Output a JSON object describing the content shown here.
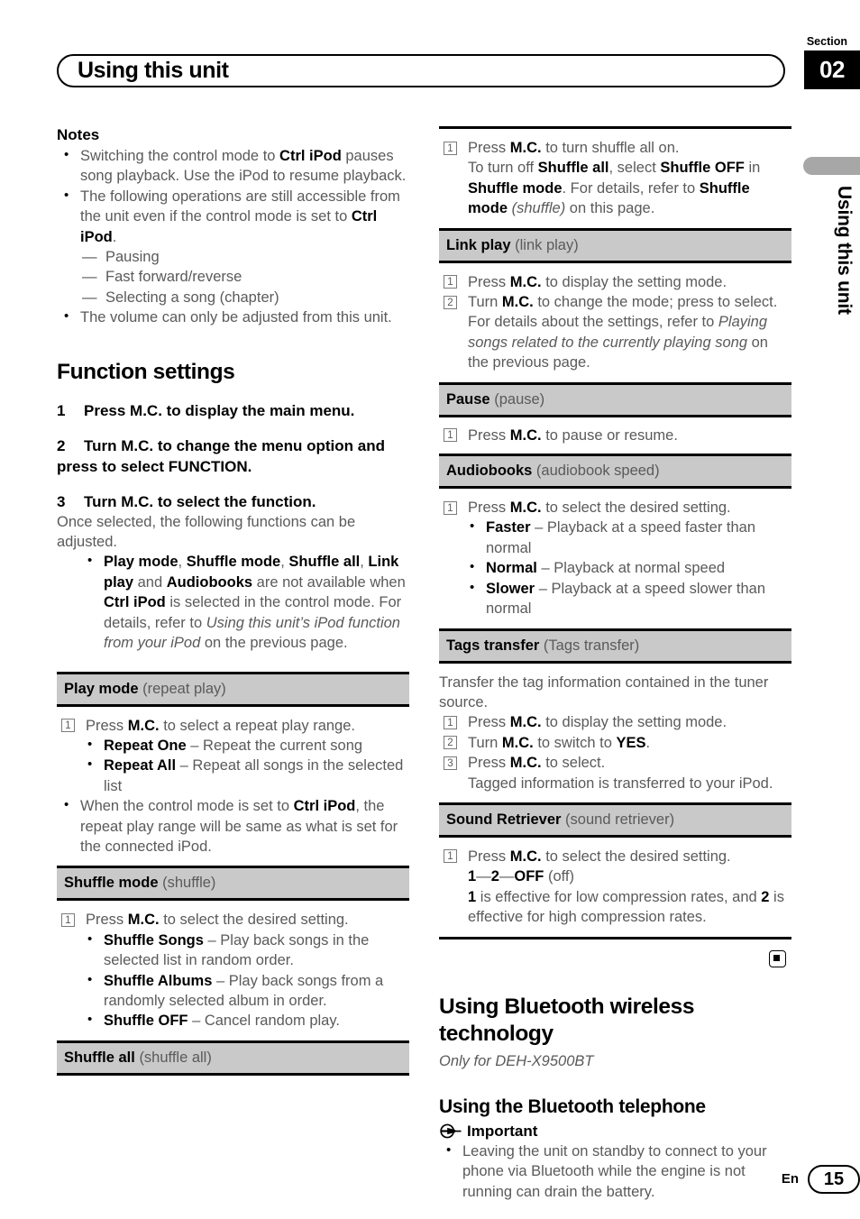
{
  "header": {
    "title": "Using this unit",
    "section_word": "Section",
    "section_number": "02"
  },
  "side_tab": {
    "label": "Using this unit"
  },
  "footer": {
    "lang": "En",
    "page": "15"
  },
  "left_column": {
    "notes_heading": "Notes",
    "notes": [
      "Switching the control mode to <b>Ctrl iPod</b> pauses song playback. Use the iPod to resume playback.",
      "The following operations are still accessible from the unit even if the control mode is set to <b>Ctrl iPod</b>.",
      "The volume can only be adjusted from this unit."
    ],
    "notes_sub_items": [
      "Pausing",
      "Fast forward/reverse",
      "Selecting a song (chapter)"
    ],
    "function_settings": {
      "heading": "Function settings",
      "steps": [
        {
          "n": "1",
          "text": "Press M.C. to display the main menu."
        },
        {
          "n": "2",
          "text": "Turn M.C. to change the menu option and press to select FUNCTION."
        },
        {
          "n": "3",
          "text": "Turn M.C. to select the function."
        }
      ],
      "intro": "Once selected, the following functions can be adjusted.",
      "bullet": "<b>Play mode</b>, <b>Shuffle mode</b>, <b>Shuffle all</b>, <b>Link play</b> and <b>Audiobooks</b> are not available when <b>Ctrl iPod</b> is selected in the control mode. For details, refer to <i>Using this unit&rsquo;s iPod function from your iPod</i> on the previous page."
    },
    "functions": [
      {
        "name": "Play mode",
        "display": "(repeat play)",
        "steps": [
          {
            "n": "1",
            "text": "Press <b>M.C.</b> to select a repeat play range."
          }
        ],
        "sub_bullets": [
          "<b>Repeat One</b> &ndash; Repeat the current song",
          "<b>Repeat All</b> &ndash; Repeat all songs in the selected list"
        ],
        "bullets": [
          "When the control mode is set to <b>Ctrl iPod</b>, the repeat play range will be same as what is set for the connected iPod."
        ]
      },
      {
        "name": "Shuffle mode",
        "display": "(shuffle)",
        "steps": [
          {
            "n": "1",
            "text": "Press <b>M.C.</b> to select the desired setting."
          }
        ],
        "sub_bullets": [
          "<b>Shuffle Songs</b> &ndash; Play back songs in the selected list in random order.",
          "<b>Shuffle Albums</b> &ndash; Play back songs from a randomly selected album in order.",
          "<b>Shuffle OFF</b> &ndash; Cancel random play."
        ],
        "bullets": []
      },
      {
        "name": "Shuffle all",
        "display": "(shuffle all)",
        "steps": [],
        "sub_bullets": [],
        "bullets": []
      }
    ]
  },
  "right_column": {
    "shuffle_all_body": {
      "steps": [
        {
          "n": "1",
          "text": "Press <b>M.C.</b> to turn shuffle all on.<br>To turn off <b>Shuffle all</b>, select <b>Shuffle OFF</b> in <b>Shuffle mode</b>. For details, refer to <b>Shuffle mode</b> <i>(shuffle)</i> on this page."
        }
      ]
    },
    "functions": [
      {
        "name": "Link play",
        "display": "(link play)",
        "steps": [
          {
            "n": "1",
            "text": "Press <b>M.C.</b> to display the setting mode."
          },
          {
            "n": "2",
            "text": "Turn <b>M.C.</b> to change the mode; press to select.<br>For details about the settings, refer to <i>Playing songs related to the currently playing song</i> on the previous page."
          }
        ],
        "intro": "",
        "sub_bullets": []
      },
      {
        "name": "Pause",
        "display": "(pause)",
        "steps": [
          {
            "n": "1",
            "text": "Press <b>M.C.</b> to pause or resume."
          }
        ],
        "intro": "",
        "sub_bullets": []
      },
      {
        "name": "Audiobooks",
        "display": "(audiobook speed)",
        "steps": [
          {
            "n": "1",
            "text": "Press <b>M.C.</b> to select the desired setting."
          }
        ],
        "intro": "",
        "sub_bullets": [
          "<b>Faster</b> &ndash; Playback at a speed faster than normal",
          "<b>Normal</b> &ndash; Playback at normal speed",
          "<b>Slower</b> &ndash; Playback at a speed slower than normal"
        ]
      },
      {
        "name": "Tags transfer",
        "display": "(Tags transfer)",
        "intro": "Transfer the tag information contained in the tuner source.",
        "steps": [
          {
            "n": "1",
            "text": "Press <b>M.C.</b> to display the setting mode."
          },
          {
            "n": "2",
            "text": "Turn <b>M.C.</b> to switch to <b>YES</b>."
          },
          {
            "n": "3",
            "text": "Press <b>M.C.</b> to select.<br>Tagged information is transferred to your iPod."
          }
        ],
        "sub_bullets": []
      },
      {
        "name": "Sound Retriever",
        "display": "(sound retriever)",
        "intro": "",
        "steps": [
          {
            "n": "1",
            "text": "Press <b>M.C.</b> to select the desired setting.<br><b>1</b>&mdash;<b>2</b>&mdash;<b>OFF</b> (off)<br><b>1</b> is effective for low compression rates, and <b>2</b> is effective for high compression rates."
          }
        ],
        "sub_bullets": []
      }
    ],
    "bluetooth": {
      "heading": "Using Bluetooth wireless technology",
      "subnote": "Only for DEH-X9500BT",
      "subheading": "Using the Bluetooth telephone",
      "important_label": "Important",
      "important_bullets": [
        "Leaving the unit on standby to connect to your phone via Bluetooth while the engine is not running can drain the battery."
      ]
    }
  },
  "icons": {
    "end_mark": "filled-square-in-rounded-box",
    "important": "megaphone-icon"
  },
  "colors": {
    "header_gray": "#c9c9c9",
    "tab_gray": "#a7a7a7",
    "body_text": "#5a5a5a",
    "bold_text": "#000000"
  }
}
